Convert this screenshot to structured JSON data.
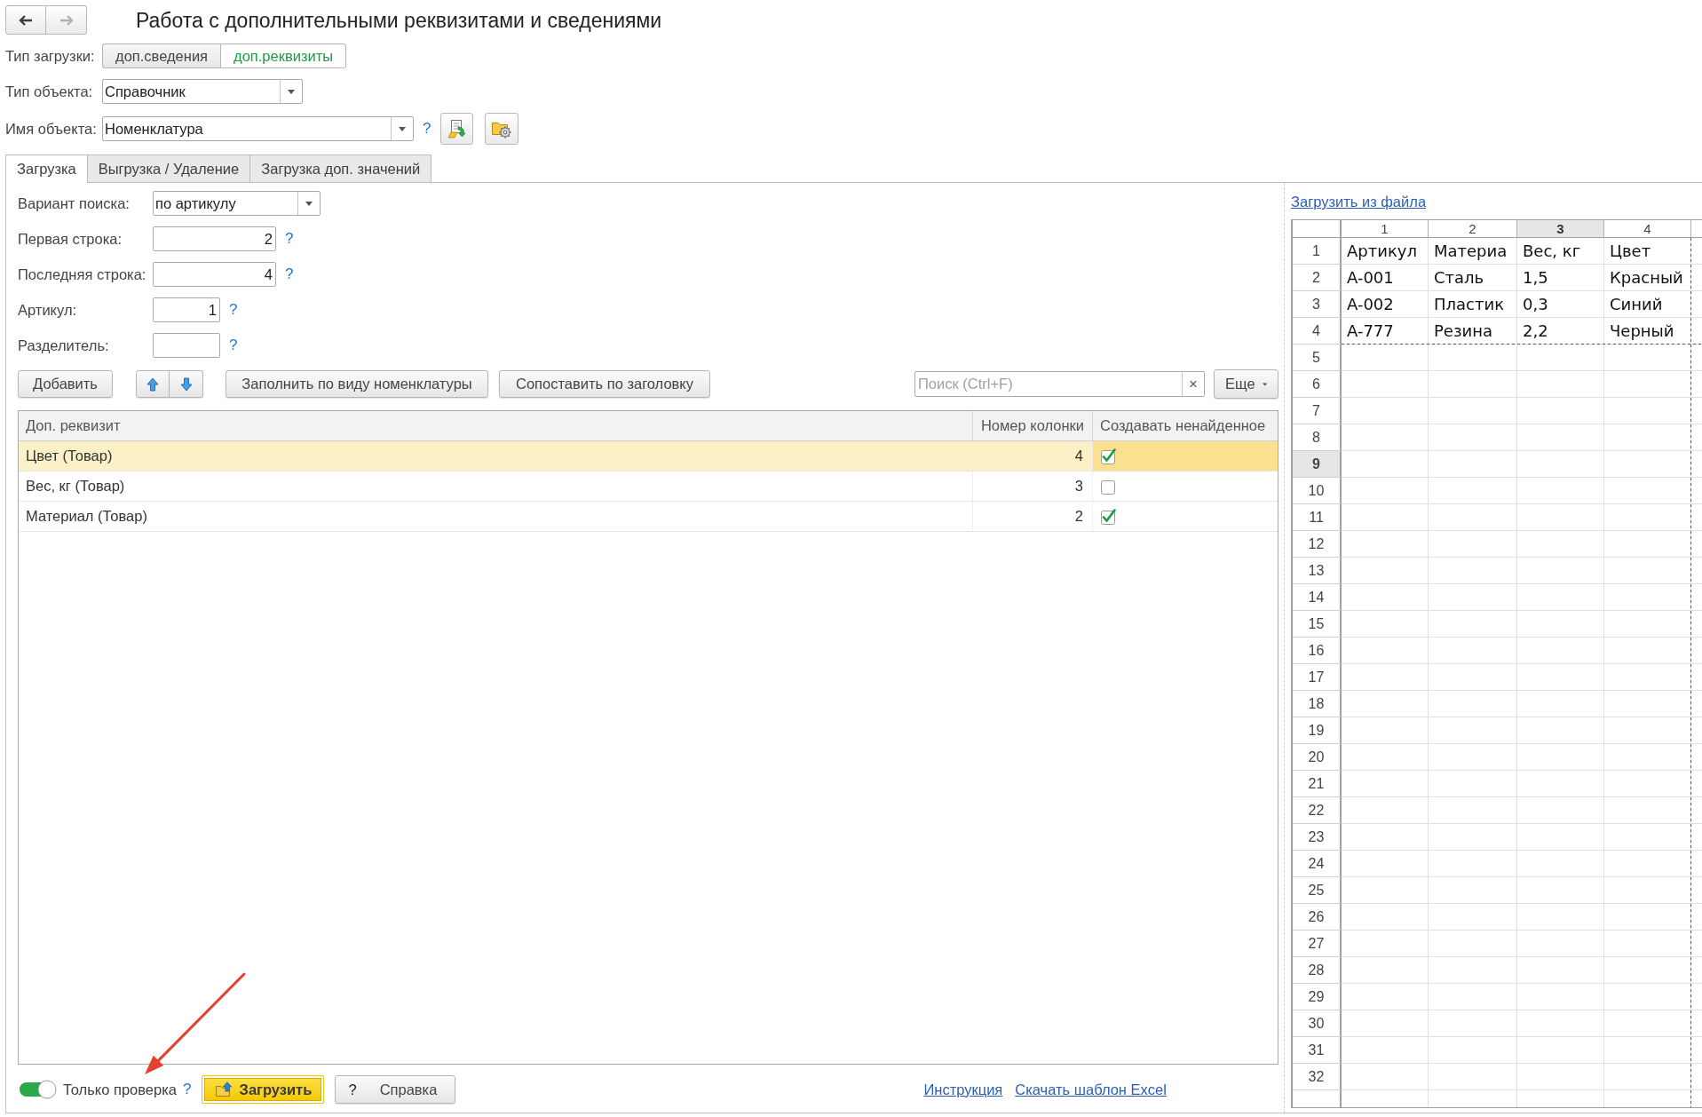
{
  "window": {
    "title": "Работа с дополнительными реквизитами и сведениями"
  },
  "navigation": [
    {
      "kind": "back",
      "disabled": false
    },
    {
      "kind": "forward",
      "disabled": true
    }
  ],
  "load_type": {
    "label": "Тип загрузки:",
    "options": [
      {
        "label": "доп.сведения",
        "selected": false
      },
      {
        "label": "доп.реквизиты",
        "selected": true
      }
    ]
  },
  "object_type": {
    "label": "Тип объекта:",
    "value": "Справочник"
  },
  "object_name": {
    "label": "Имя объекта:",
    "value": "Номенклатура",
    "help": "?"
  },
  "tabs": [
    {
      "label": "Загрузка",
      "selected": true
    },
    {
      "label": "Выгрузка / Удаление",
      "selected": false
    },
    {
      "label": "Загрузка доп. значений",
      "selected": false
    }
  ],
  "search_settings": [
    {
      "kind": "dropdown",
      "label": "Вариант поиска:",
      "value": "по артикулу"
    },
    {
      "kind": "number",
      "label": "Первая строка:",
      "value": "2",
      "help": "?"
    },
    {
      "kind": "number",
      "label": "Последняя строка:",
      "value": "4",
      "help": "?"
    },
    {
      "kind": "number",
      "label": "Артикул:",
      "value": "1",
      "help": "?"
    },
    {
      "kind": "text",
      "label": "Разделитель:",
      "help": "?"
    }
  ],
  "table_toolbar": {
    "add_button": "Добавить",
    "fill_button": "Заполнить по виду номенклатуры",
    "match_button": "Сопоставить по заголовку",
    "search": {
      "placeholder": "Поиск (Ctrl+F)",
      "clear": "×"
    },
    "more_button": "Еще"
  },
  "table": {
    "columns": [
      {
        "title": "Доп. реквизит",
        "focused": false
      },
      {
        "title": "Номер колонки",
        "focused": false
      },
      {
        "title": "Создавать ненайденное",
        "focused": true
      }
    ],
    "rows": [
      {
        "name": "Цвет (Товар)",
        "column": "4",
        "create": true,
        "selected": true
      },
      {
        "name": "Вес, кг (Товар)",
        "column": "3",
        "create": false,
        "selected": false
      },
      {
        "name": "Материал (Товар)",
        "column": "2",
        "create": true,
        "selected": false
      }
    ]
  },
  "footer": {
    "switch": {
      "label": "Только проверка",
      "on": true,
      "help": "?"
    },
    "buttons": [
      {
        "kind": "primary",
        "label": "Загрузить"
      },
      {
        "kind": "help",
        "icon": "?",
        "label": "Справка"
      }
    ],
    "links": [
      "Инструкция",
      "Скачать шаблон Excel"
    ]
  },
  "spreadsheet": {
    "link": "Загрузить из файла",
    "columns": [
      {
        "label": "1",
        "selected": false
      },
      {
        "label": "2",
        "selected": false
      },
      {
        "label": "3",
        "selected": true
      },
      {
        "label": "4",
        "selected": false
      }
    ],
    "rows": [
      {
        "label": "1",
        "selected": false,
        "cells": [
          "Артикул",
          "Материа",
          "Вес, кг",
          "Цвет"
        ]
      },
      {
        "label": "2",
        "selected": false,
        "cells": [
          "A-001",
          "Сталь",
          "1,5",
          "Красный"
        ]
      },
      {
        "label": "3",
        "selected": false,
        "cells": [
          "A-002",
          "Пластик",
          "0,3",
          "Синий"
        ]
      },
      {
        "label": "4",
        "selected": false,
        "cells": [
          "A-777",
          "Резина",
          "2,2",
          "Черный"
        ]
      },
      {
        "label": "5",
        "selected": false
      },
      {
        "label": "6",
        "selected": false
      },
      {
        "label": "7",
        "selected": false
      },
      {
        "label": "8",
        "selected": false
      },
      {
        "label": "9",
        "selected": true
      },
      {
        "label": "10",
        "selected": false
      },
      {
        "label": "11",
        "selected": false
      },
      {
        "label": "12",
        "selected": false
      },
      {
        "label": "13",
        "selected": false
      },
      {
        "label": "14",
        "selected": false
      },
      {
        "label": "15",
        "selected": false
      },
      {
        "label": "16",
        "selected": false
      },
      {
        "label": "17",
        "selected": false
      },
      {
        "label": "18",
        "selected": false
      },
      {
        "label": "19",
        "selected": false
      },
      {
        "label": "20",
        "selected": false
      },
      {
        "label": "21",
        "selected": false
      },
      {
        "label": "22",
        "selected": false
      },
      {
        "label": "23",
        "selected": false
      },
      {
        "label": "24",
        "selected": false
      },
      {
        "label": "25",
        "selected": false
      },
      {
        "label": "26",
        "selected": false
      },
      {
        "label": "27",
        "selected": false
      },
      {
        "label": "28",
        "selected": false
      },
      {
        "label": "29",
        "selected": false
      },
      {
        "label": "30",
        "selected": false
      },
      {
        "label": "31",
        "selected": false
      },
      {
        "label": "32",
        "selected": false
      }
    ]
  }
}
